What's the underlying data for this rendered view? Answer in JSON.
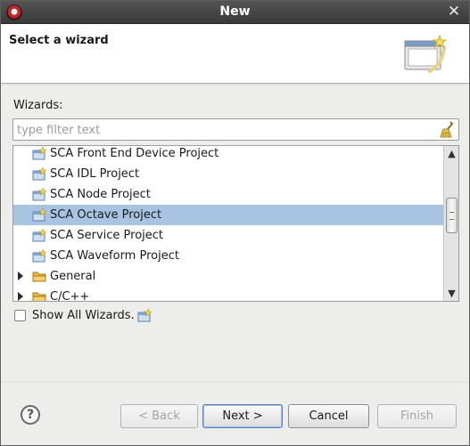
{
  "window": {
    "title": "New"
  },
  "banner": {
    "heading": "Select a wizard"
  },
  "wizards": {
    "label": "Wizards:"
  },
  "filter": {
    "value": "",
    "placeholder": "type filter text"
  },
  "tree": {
    "items": [
      {
        "label": "SCA Front End Device Project",
        "type": "wizard",
        "selected": false
      },
      {
        "label": "SCA IDL Project",
        "type": "wizard",
        "selected": false
      },
      {
        "label": "SCA Node Project",
        "type": "wizard",
        "selected": false
      },
      {
        "label": "SCA Octave Project",
        "type": "wizard",
        "selected": true
      },
      {
        "label": "SCA Service Project",
        "type": "wizard",
        "selected": false
      },
      {
        "label": "SCA Waveform Project",
        "type": "wizard",
        "selected": false
      },
      {
        "label": "General",
        "type": "folder",
        "selected": false
      },
      {
        "label": "C/C++",
        "type": "folder",
        "selected": false
      }
    ]
  },
  "options": {
    "show_all_label": "Show All Wizards.",
    "show_all_checked": false
  },
  "buttons": {
    "help": "?",
    "back": "< Back",
    "next": "Next >",
    "cancel": "Cancel",
    "finish": "Finish"
  },
  "icons": {
    "app": "app-logo-icon",
    "close": "close-icon",
    "banner": "wizard-banner-icon",
    "clear_filter": "clear-filter-icon",
    "wizard": "new-project-wizard-icon",
    "folder": "folder-icon",
    "expander": "tree-expand-icon"
  },
  "colors": {
    "selection": "#a9c3e3",
    "titlebar": "#3f3f3f"
  }
}
